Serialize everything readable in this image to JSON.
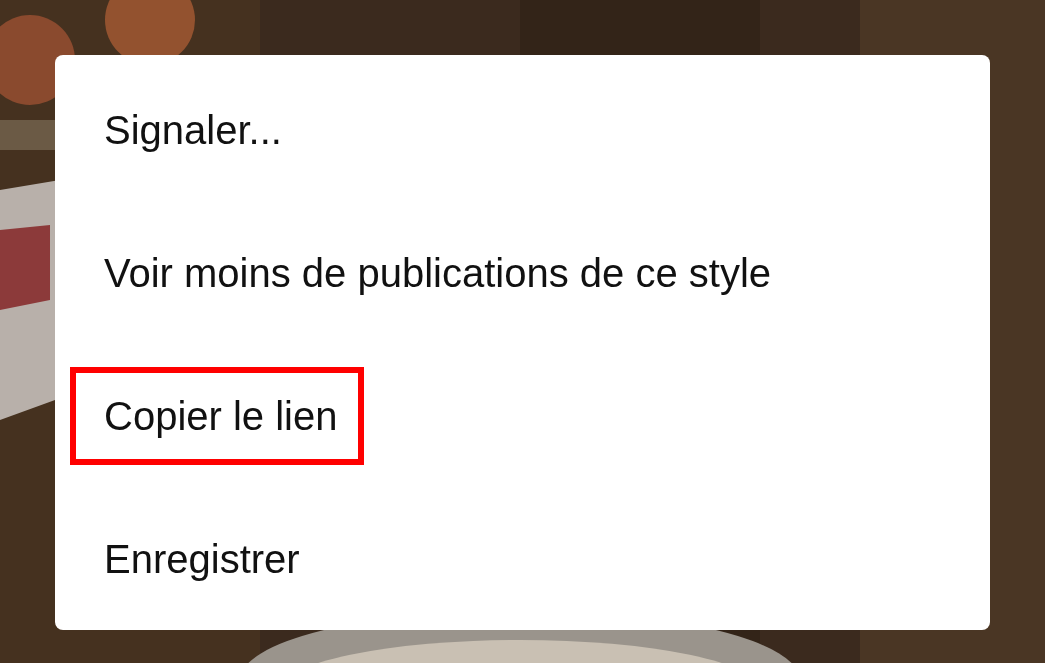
{
  "menu": {
    "items": [
      {
        "label": "Signaler...",
        "highlighted": false
      },
      {
        "label": "Voir moins de publications de ce style",
        "highlighted": false
      },
      {
        "label": "Copier le lien",
        "highlighted": true
      },
      {
        "label": "Enregistrer",
        "highlighted": false
      }
    ]
  }
}
